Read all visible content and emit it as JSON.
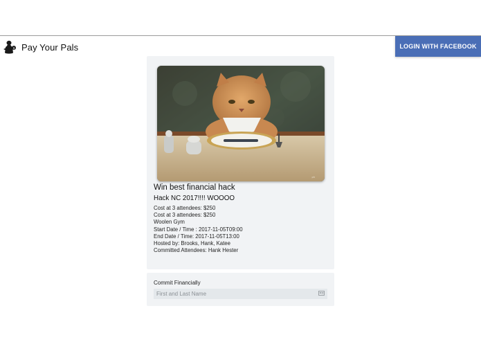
{
  "header": {
    "brand_name": "Pay Your Pals",
    "brand_icon": "money-bag-icon",
    "login_label": "LOGIN WITH FACEBOOK",
    "login_color": "#4a6eb6"
  },
  "event": {
    "title": "Win best financial hack",
    "subtitle": "Hack NC 2017!!!! WOOOO",
    "cost_line_1": "Cost at 3 attendees: $250",
    "cost_line_2": "Cost at 3 attendees: $250",
    "location": "Woolen Gym",
    "start": "Start Date / Time : 2017-11-05T09:00",
    "end": "End Date / Time: 2017-11-05T13:00",
    "hosts": "Hosted by: Brooks, Hank, Katee",
    "attendees": "Committed Attendees: Hank Hester"
  },
  "commit": {
    "label": "Commit Financially",
    "name_placeholder": "First and Last Name",
    "name_value": "",
    "input_icon": "contact-card-icon"
  },
  "colors": {
    "card_background": "#f1f3f5",
    "input_background": "#e4e8eb"
  }
}
